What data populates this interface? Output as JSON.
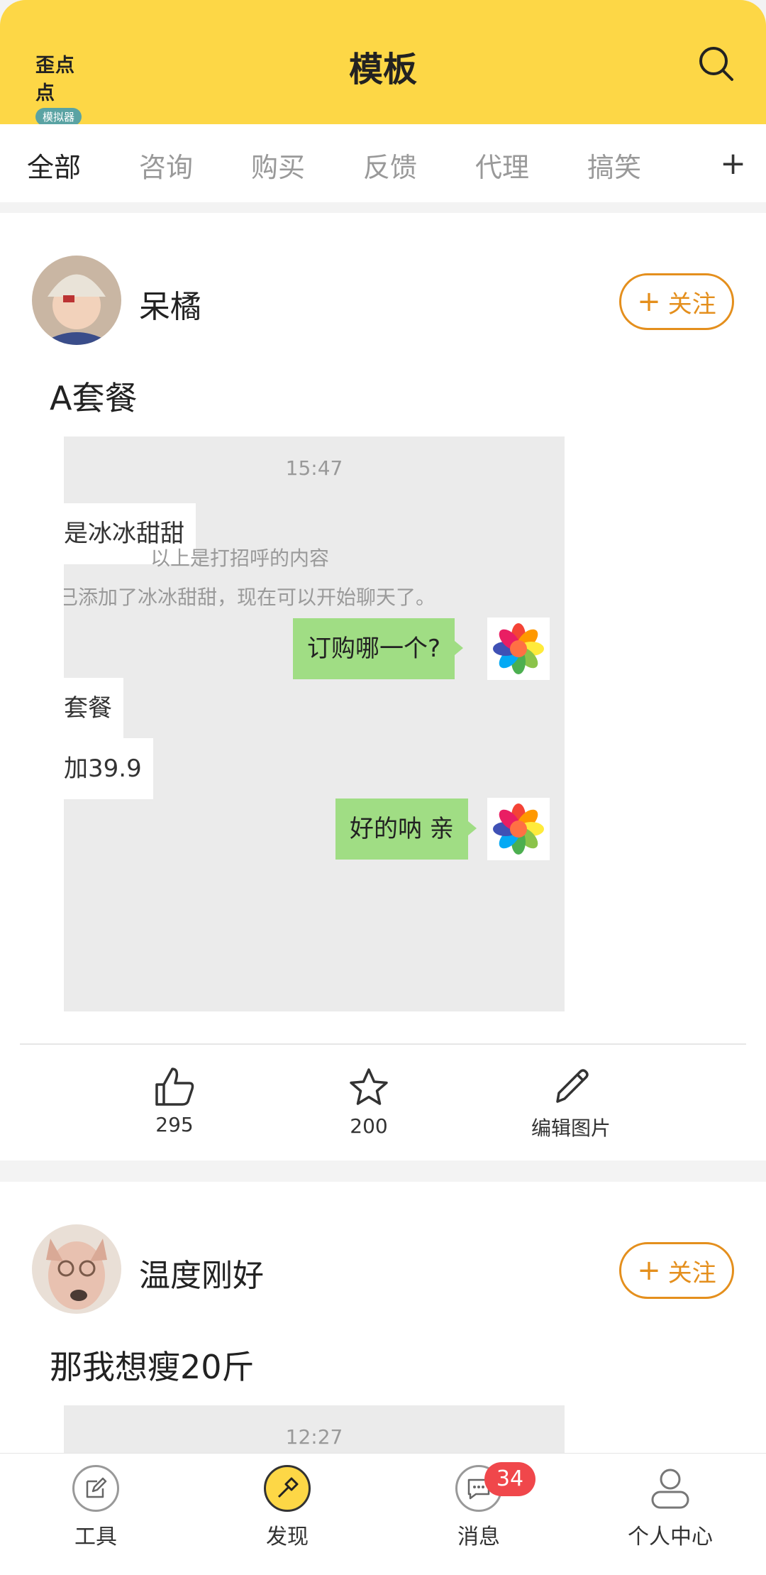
{
  "header": {
    "logo_line1": "歪点点",
    "logo_line2": "模拟器",
    "title": "模板"
  },
  "tabs": [
    "全部",
    "咨询",
    "购买",
    "反馈",
    "代理",
    "搞笑"
  ],
  "tab_add": "+",
  "posts": [
    {
      "user": "呆橘",
      "follow": "关注",
      "text": "A套餐",
      "chat": {
        "time": "15:47",
        "left1": "是冰冰甜甜",
        "sys1": "以上是打招呼的内容",
        "sys2": "已添加了冰冰甜甜，现在可以开始聊天了。",
        "right1": "订购哪一个?",
        "left2": "套餐",
        "left3": "加39.9",
        "right2": "好的呐 亲"
      },
      "likes": "295",
      "stars": "200",
      "edit": "编辑图片"
    },
    {
      "user": "温度刚好",
      "follow": "关注",
      "text": "那我想瘦20斤",
      "chat": {
        "time": "12:27"
      }
    }
  ],
  "bottom_nav": [
    {
      "label": "工具"
    },
    {
      "label": "发现"
    },
    {
      "label": "消息",
      "badge": "34"
    },
    {
      "label": "个人中心"
    }
  ],
  "colors": {
    "accent": "#fdd746",
    "follow": "#e48f1d",
    "badge": "#f0474b",
    "bubble_green": "#a0dd84"
  }
}
